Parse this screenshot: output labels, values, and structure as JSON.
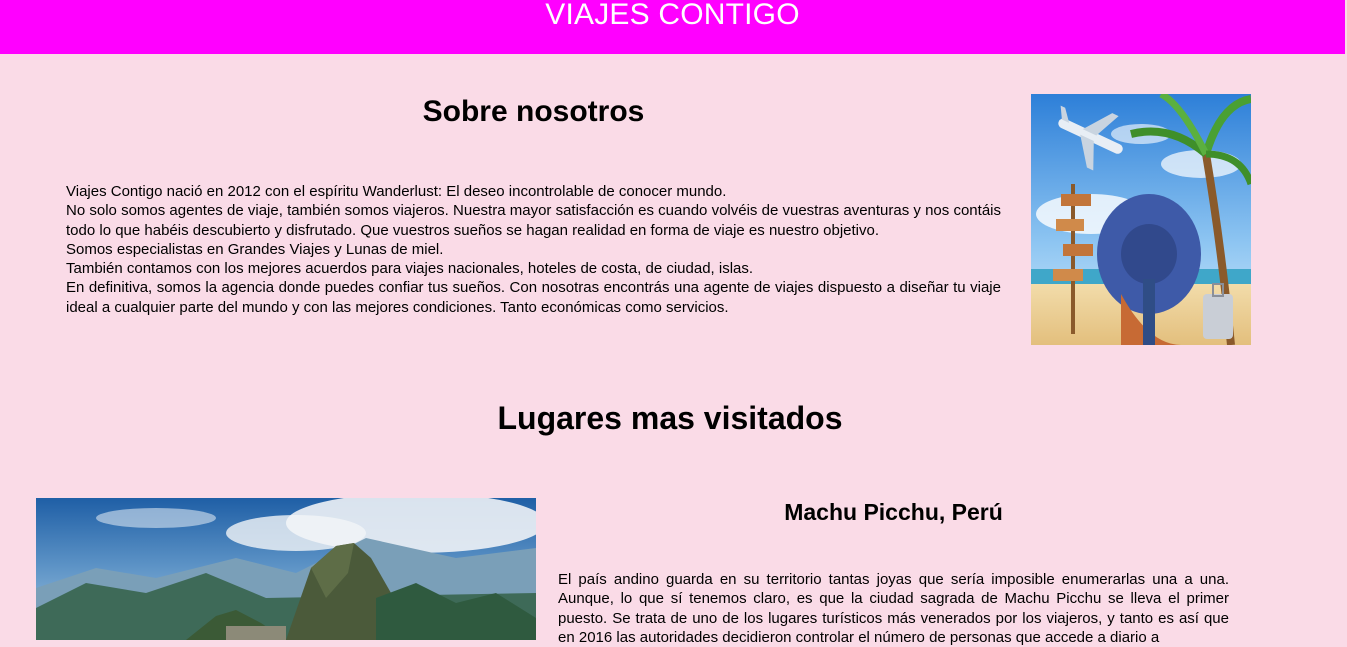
{
  "header": {
    "title": "VIAJES CONTIGO",
    "background": "#ff00ff"
  },
  "page": {
    "background": "#fadbe7"
  },
  "about": {
    "title": "Sobre nosotros",
    "paragraphs": [
      "Viajes Contigo nació en 2012 con el espíritu Wanderlust: El deseo incontrolable de conocer mundo.",
      "No solo somos agentes de viaje, también somos viajeros. Nuestra mayor satisfacción es cuando volvéis de vuestras aventuras y nos contáis todo lo que habéis descubierto y disfrutado. Que vuestros sueños se hagan realidad en forma de viaje es nuestro objetivo.",
      "Somos especialistas en Grandes Viajes y Lunas de miel.",
      "También contamos con los mejores acuerdos para viajes nacionales, hoteles de costa, de ciudad, islas.",
      "En definitiva, somos la agencia donde puedes confiar tus sueños. Con nosotras encontrás una agente de viajes dispuesto a diseñar tu viaje ideal a cualquier parte del mundo y con las mejores condiciones. Tanto económicas como servicios."
    ]
  },
  "places": {
    "title": "Lugares mas visitados",
    "items": [
      {
        "name": "Machu Picchu, Perú",
        "text": "El país andino guarda en su territorio tantas joyas que sería imposible enumerarlas una a una. Aunque, lo que sí tenemos claro, es que la ciudad sagrada de Machu Picchu se lleva el primer puesto. Se trata de uno de los lugares turísticos más venerados por los viajeros, y tanto es así que en 2016 las autoridades decidieron controlar el número de personas que accede a diario a"
      }
    ]
  }
}
